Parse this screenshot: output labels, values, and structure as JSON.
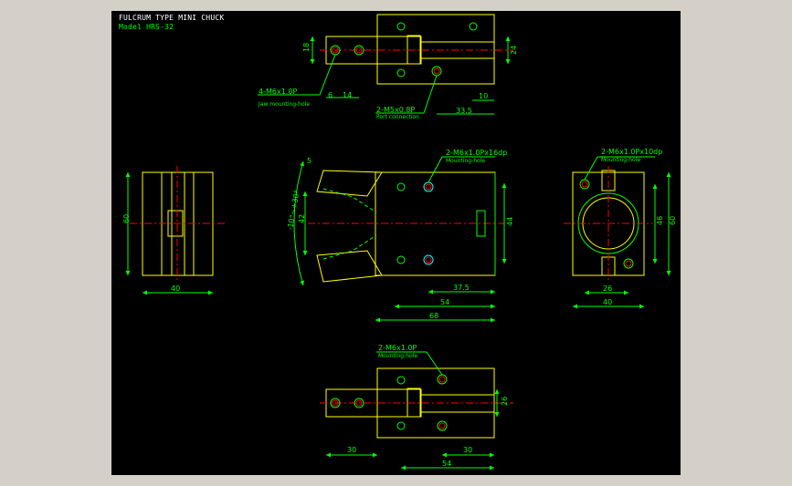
{
  "title": "FULCRUM TYPE MINI CHUCK",
  "model": "Model  HRS-32",
  "colors": {
    "background": "#000000",
    "frame": "#d4d0c8",
    "outline": "#ffff00",
    "dimension": "#00ff00",
    "centerline": "#ff0000",
    "hidden": "#00ff00",
    "hole": "#00ffff",
    "text": "#ffffff"
  },
  "top_view": {
    "dims": {
      "height_left": "18",
      "height_right": "24",
      "d6": "6",
      "d14": "14",
      "d10": "10",
      "d33": "33.5"
    },
    "callouts": {
      "mount_thread": "4-M6x1.0P",
      "mount_note": "Jaw mounting-hole",
      "port_thread": "2-M5x0.8P",
      "port_note": "Port connection"
    }
  },
  "front_view": {
    "dims": {
      "angle": "-10°~+30°",
      "d5": "5",
      "d42": "42",
      "d44": "44",
      "d37": "37.5",
      "d54": "54",
      "d68": "68"
    },
    "callouts": {
      "thread": "2-M6x1.0Px16dp",
      "note": "Mounting-hole"
    }
  },
  "left_view": {
    "dims": {
      "height": "60",
      "width": "40"
    }
  },
  "right_view": {
    "dims": {
      "d46": "46",
      "d60": "60",
      "d26": "26",
      "d40": "40"
    },
    "callouts": {
      "thread": "2-M6x1.0Px10dp",
      "note": "Mounting-hole"
    }
  },
  "bottom_view": {
    "dims": {
      "d26": "26",
      "d30a": "30",
      "d30b": "30",
      "d54": "54"
    },
    "callouts": {
      "thread": "2-M6x1.0P",
      "note": "Mounting-hole"
    }
  }
}
